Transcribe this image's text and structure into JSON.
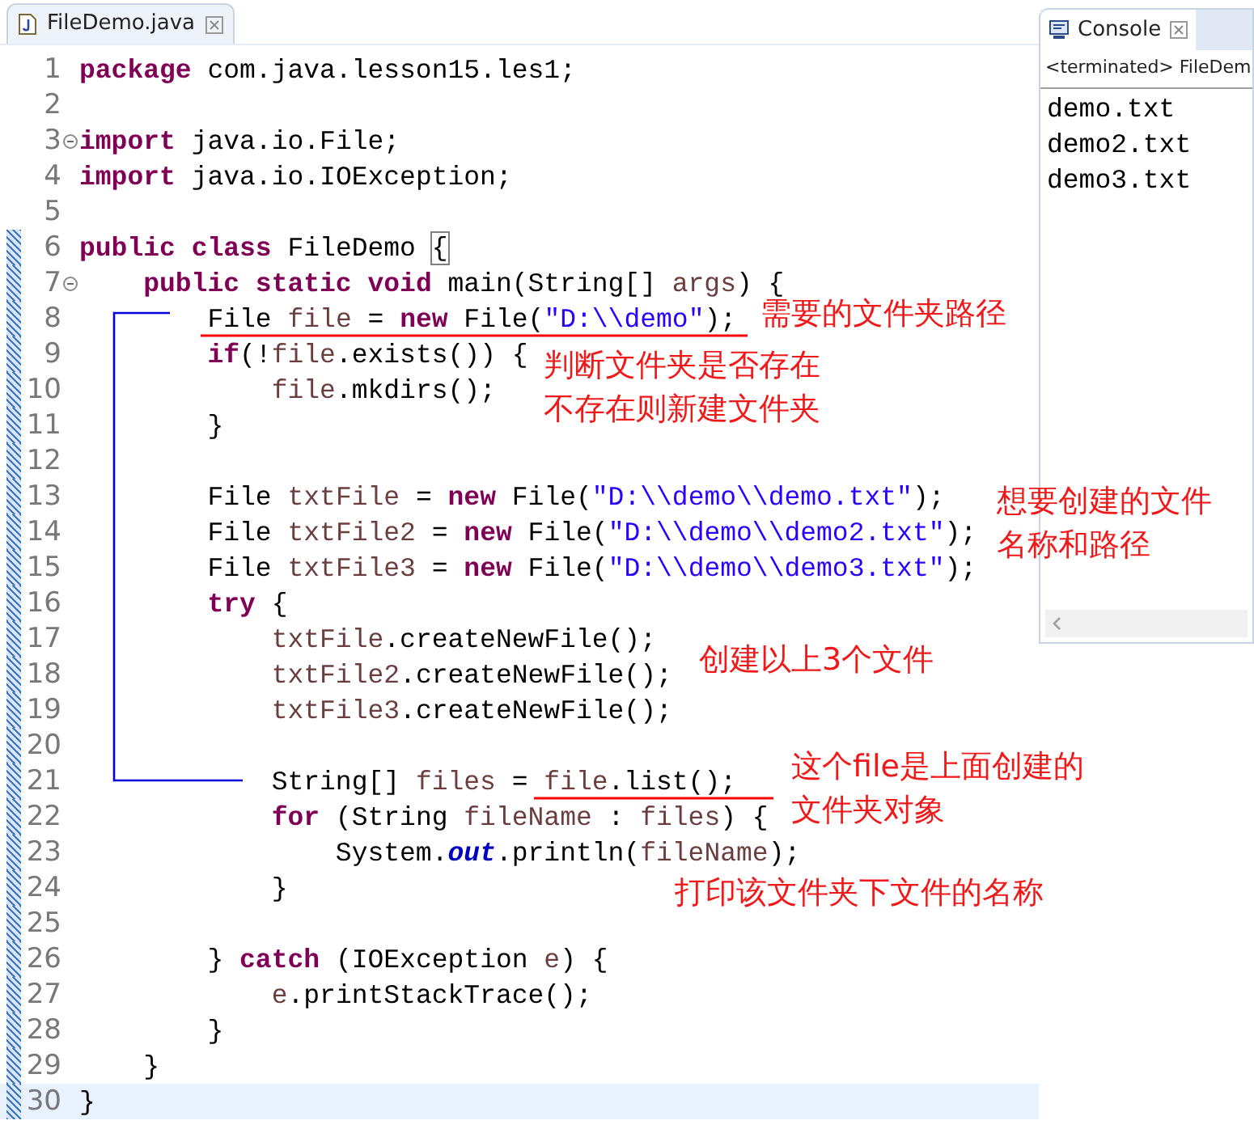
{
  "editor_tab": {
    "title": "FileDemo.java",
    "selected": true
  },
  "code_lines": [
    {
      "number": "1",
      "changed": false,
      "fold": false,
      "current": false,
      "tokens": [
        {
          "kind": "keyword",
          "text": "package"
        },
        {
          "kind": "text",
          "text": " com.java.lesson15.les1;"
        }
      ]
    },
    {
      "number": "2",
      "changed": false,
      "fold": false,
      "current": false
    },
    {
      "number": "3",
      "changed": false,
      "fold": true,
      "current": false,
      "tokens": [
        {
          "kind": "keyword",
          "text": "import"
        },
        {
          "kind": "text",
          "text": " java.io.File;"
        }
      ]
    },
    {
      "number": "4",
      "changed": false,
      "fold": false,
      "current": false,
      "tokens": [
        {
          "kind": "keyword",
          "text": "import"
        },
        {
          "kind": "text",
          "text": " java.io.IOException;"
        }
      ]
    },
    {
      "number": "5",
      "changed": false,
      "fold": false,
      "current": false
    },
    {
      "number": "6",
      "changed": true,
      "fold": false,
      "current": false,
      "tokens": [
        {
          "kind": "keyword",
          "text": "public "
        },
        {
          "kind": "keyword",
          "text": "class "
        },
        {
          "kind": "text",
          "text": "FileDemo "
        },
        {
          "kind": "matched_brace",
          "text": "{"
        }
      ]
    },
    {
      "number": "7",
      "changed": true,
      "fold": true,
      "current": false,
      "tokens": [
        {
          "kind": "keyword",
          "text": "    public "
        },
        {
          "kind": "keyword",
          "text": "static "
        },
        {
          "kind": "keyword",
          "text": "void "
        },
        {
          "kind": "text",
          "text": "main(String[] "
        },
        {
          "kind": "variable",
          "text": "args"
        },
        {
          "kind": "text",
          "text": ") {"
        }
      ]
    },
    {
      "number": "8",
      "changed": true,
      "fold": false,
      "current": false,
      "tokens": [
        {
          "kind": "text",
          "text": "        File "
        },
        {
          "kind": "variable",
          "text": "file"
        },
        {
          "kind": "text",
          "text": " = "
        },
        {
          "kind": "keyword",
          "text": "new"
        },
        {
          "kind": "text",
          "text": " File("
        },
        {
          "kind": "string",
          "text": "\"D:\\\\demo\""
        },
        {
          "kind": "text",
          "text": ");"
        }
      ]
    },
    {
      "number": "9",
      "changed": true,
      "fold": false,
      "current": false,
      "tokens": [
        {
          "kind": "keyword",
          "text": "        if"
        },
        {
          "kind": "text",
          "text": "(!"
        },
        {
          "kind": "variable",
          "text": "file"
        },
        {
          "kind": "text",
          "text": ".exists()) {"
        }
      ]
    },
    {
      "number": "10",
      "changed": true,
      "fold": false,
      "current": false,
      "tokens": [
        {
          "kind": "variable",
          "text": "            file"
        },
        {
          "kind": "text",
          "text": ".mkdirs();"
        }
      ]
    },
    {
      "number": "11",
      "changed": true,
      "fold": false,
      "current": false,
      "tokens": [
        {
          "kind": "text",
          "text": "        }"
        }
      ]
    },
    {
      "number": "12",
      "changed": true,
      "fold": false,
      "current": false
    },
    {
      "number": "13",
      "changed": true,
      "fold": false,
      "current": false,
      "tokens": [
        {
          "kind": "text",
          "text": "        File "
        },
        {
          "kind": "variable",
          "text": "txtFile"
        },
        {
          "kind": "text",
          "text": " = "
        },
        {
          "kind": "keyword",
          "text": "new"
        },
        {
          "kind": "text",
          "text": " File("
        },
        {
          "kind": "string",
          "text": "\"D:\\\\demo\\\\demo.txt\""
        },
        {
          "kind": "text",
          "text": ");"
        }
      ]
    },
    {
      "number": "14",
      "changed": true,
      "fold": false,
      "current": false,
      "tokens": [
        {
          "kind": "text",
          "text": "        File "
        },
        {
          "kind": "variable",
          "text": "txtFile2"
        },
        {
          "kind": "text",
          "text": " = "
        },
        {
          "kind": "keyword",
          "text": "new"
        },
        {
          "kind": "text",
          "text": " File("
        },
        {
          "kind": "string",
          "text": "\"D:\\\\demo\\\\demo2.txt\""
        },
        {
          "kind": "text",
          "text": ");"
        }
      ]
    },
    {
      "number": "15",
      "changed": true,
      "fold": false,
      "current": false,
      "tokens": [
        {
          "kind": "text",
          "text": "        File "
        },
        {
          "kind": "variable",
          "text": "txtFile3"
        },
        {
          "kind": "text",
          "text": " = "
        },
        {
          "kind": "keyword",
          "text": "new"
        },
        {
          "kind": "text",
          "text": " File("
        },
        {
          "kind": "string",
          "text": "\"D:\\\\demo\\\\demo3.txt\""
        },
        {
          "kind": "text",
          "text": ");"
        }
      ]
    },
    {
      "number": "16",
      "changed": true,
      "fold": false,
      "current": false,
      "tokens": [
        {
          "kind": "keyword",
          "text": "        try"
        },
        {
          "kind": "text",
          "text": " {"
        }
      ]
    },
    {
      "number": "17",
      "changed": true,
      "fold": false,
      "current": false,
      "tokens": [
        {
          "kind": "variable",
          "text": "            txtFile"
        },
        {
          "kind": "text",
          "text": ".createNewFile();"
        }
      ]
    },
    {
      "number": "18",
      "changed": true,
      "fold": false,
      "current": false,
      "tokens": [
        {
          "kind": "variable",
          "text": "            txtFile2"
        },
        {
          "kind": "text",
          "text": ".createNewFile();"
        }
      ]
    },
    {
      "number": "19",
      "changed": true,
      "fold": false,
      "current": false,
      "tokens": [
        {
          "kind": "variable",
          "text": "            txtFile3"
        },
        {
          "kind": "text",
          "text": ".createNewFile();"
        }
      ]
    },
    {
      "number": "20",
      "changed": true,
      "fold": false,
      "current": false
    },
    {
      "number": "21",
      "changed": true,
      "fold": false,
      "current": false,
      "tokens": [
        {
          "kind": "text",
          "text": "            String[] "
        },
        {
          "kind": "variable",
          "text": "files"
        },
        {
          "kind": "text",
          "text": " = "
        },
        {
          "kind": "variable",
          "text": "file"
        },
        {
          "kind": "text",
          "text": ".list();"
        }
      ]
    },
    {
      "number": "22",
      "changed": true,
      "fold": false,
      "current": false,
      "tokens": [
        {
          "kind": "keyword",
          "text": "            for"
        },
        {
          "kind": "text",
          "text": " (String "
        },
        {
          "kind": "variable",
          "text": "fileName"
        },
        {
          "kind": "text",
          "text": " : "
        },
        {
          "kind": "variable",
          "text": "files"
        },
        {
          "kind": "text",
          "text": ") {"
        }
      ]
    },
    {
      "number": "23",
      "changed": true,
      "fold": false,
      "current": false,
      "tokens": [
        {
          "kind": "text",
          "text": "                System."
        },
        {
          "kind": "static_field",
          "text": "out"
        },
        {
          "kind": "text",
          "text": ".println("
        },
        {
          "kind": "variable",
          "text": "fileName"
        },
        {
          "kind": "text",
          "text": ");"
        }
      ]
    },
    {
      "number": "24",
      "changed": true,
      "fold": false,
      "current": false,
      "tokens": [
        {
          "kind": "text",
          "text": "            }"
        }
      ]
    },
    {
      "number": "25",
      "changed": true,
      "fold": false,
      "current": false
    },
    {
      "number": "26",
      "changed": true,
      "fold": false,
      "current": false,
      "tokens": [
        {
          "kind": "text",
          "text": "        } "
        },
        {
          "kind": "keyword",
          "text": "catch"
        },
        {
          "kind": "text",
          "text": " (IOException "
        },
        {
          "kind": "variable",
          "text": "e"
        },
        {
          "kind": "text",
          "text": ") {"
        }
      ]
    },
    {
      "number": "27",
      "changed": true,
      "fold": false,
      "current": false,
      "tokens": [
        {
          "kind": "variable",
          "text": "            e"
        },
        {
          "kind": "text",
          "text": ".printStackTrace();"
        }
      ]
    },
    {
      "number": "28",
      "changed": true,
      "fold": false,
      "current": false,
      "tokens": [
        {
          "kind": "text",
          "text": "        }"
        }
      ]
    },
    {
      "number": "29",
      "changed": true,
      "fold": false,
      "current": false,
      "tokens": [
        {
          "kind": "text",
          "text": "    }"
        }
      ]
    },
    {
      "number": "30",
      "changed": true,
      "fold": false,
      "current": true,
      "tokens": [
        {
          "kind": "text",
          "text": "}"
        }
      ]
    }
  ],
  "console": {
    "tab_title": "Console",
    "selected": true,
    "status": "<terminated> FileDem",
    "output": [
      "demo.txt",
      "demo2.txt",
      "demo3.txt"
    ]
  },
  "annotations": [
    {
      "lines": [
        "需要的文件夹路径"
      ]
    },
    {
      "lines": [
        "判断文件夹是否存在",
        "不存在则新建文件夹"
      ]
    },
    {
      "lines": [
        "想要创建的文件",
        "名称和路径"
      ]
    },
    {
      "lines": [
        "创建以上3个文件"
      ]
    },
    {
      "lines": [
        "这个file是上面创建的",
        "文件夹对象"
      ]
    },
    {
      "lines": [
        "打印该文件夹下文件的名称"
      ]
    }
  ]
}
